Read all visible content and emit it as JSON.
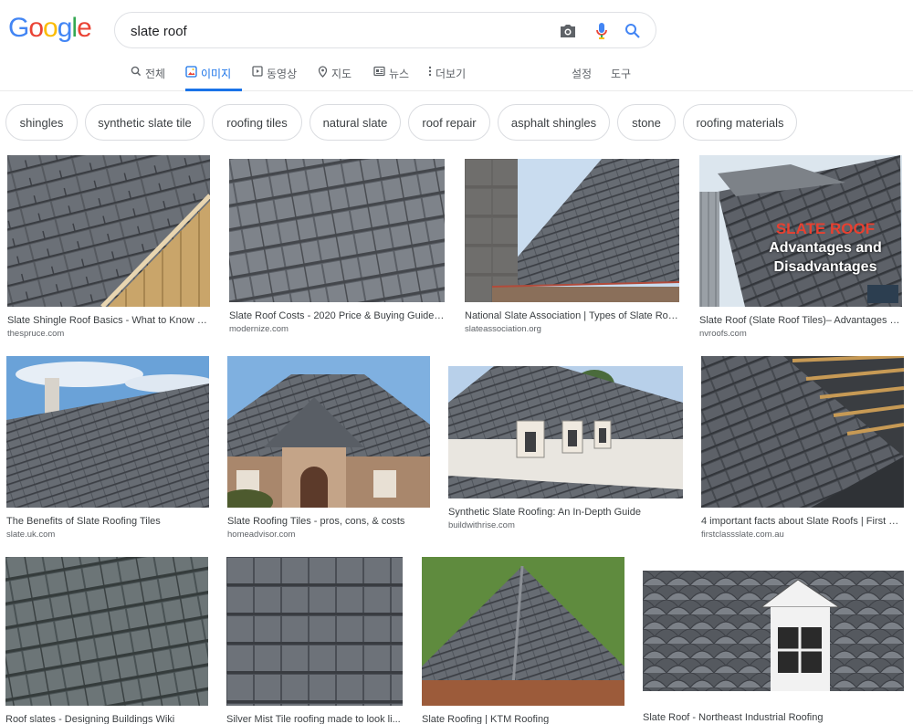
{
  "search": {
    "query": "slate roof"
  },
  "logo": {
    "letters": [
      "G",
      "o",
      "o",
      "g",
      "l",
      "e"
    ],
    "colors": [
      "#4285f4",
      "#ea4335",
      "#fbbc05",
      "#4285f4",
      "#34a853",
      "#ea4335"
    ]
  },
  "tabs": {
    "all": "전체",
    "images": "이미지",
    "videos": "동영상",
    "maps": "지도",
    "news": "뉴스",
    "more": "더보기",
    "settings": "설정",
    "tools": "도구"
  },
  "chips": [
    "shingles",
    "synthetic slate tile",
    "roofing tiles",
    "natural slate",
    "roof repair",
    "asphalt shingles",
    "stone",
    "roofing materials"
  ],
  "results": [
    {
      "title": "Slate Shingle Roof Basics - What to Know Be...",
      "source": "thespruce.com"
    },
    {
      "title": "Slate Roof Costs - 2020 Price & Buying Guide - - ...",
      "source": "modernize.com"
    },
    {
      "title": "National Slate Association | Types of Slate Roofs",
      "source": "slateassociation.org"
    },
    {
      "title": "Slate Roof (Slate Roof Tiles)– Advantages an...",
      "source": "nvroofs.com",
      "overlay": {
        "line1": "SLATE ROOF",
        "line2": "Advantages and",
        "line3": "Disadvantages"
      }
    },
    {
      "title": "The Benefits of Slate Roofing Tiles",
      "source": "slate.uk.com"
    },
    {
      "title": "Slate Roofing Tiles - pros, cons, & costs",
      "source": "homeadvisor.com"
    },
    {
      "title": "Synthetic Slate Roofing: An In-Depth Guide",
      "source": "buildwithrise.com"
    },
    {
      "title": "4 important facts about Slate Roofs | First Cl...",
      "source": "firstclassslate.com.au"
    },
    {
      "title": "Roof slates - Designing Buildings Wiki",
      "source": ""
    },
    {
      "title": "Silver Mist Tile roofing made to look li...",
      "source": ""
    },
    {
      "title": "Slate Roofing | KTM Roofing",
      "source": ""
    },
    {
      "title": "Slate Roof - Northeast Industrial Roofing",
      "source": ""
    }
  ],
  "colors": {
    "accent": "#1a73e8",
    "chip_border": "#dadce0",
    "muted": "#5f6368"
  }
}
